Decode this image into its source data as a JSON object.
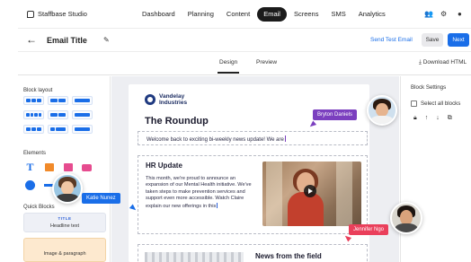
{
  "app": {
    "brand": "Staffbase Studio",
    "nav": [
      "Dashboard",
      "Planning",
      "Content",
      "Email",
      "Screens",
      "SMS",
      "Analytics"
    ],
    "active_nav": "Email"
  },
  "header": {
    "title": "Email Title",
    "send_test": "Send Test Email",
    "save": "Save",
    "next": "Next"
  },
  "tabs": {
    "design": "Design",
    "preview": "Preview",
    "download": "Download HTML"
  },
  "left_panel": {
    "block_layout": "Block layout",
    "elements": "Elements",
    "quick_blocks": "Quick Blocks",
    "quick_block_items": [
      {
        "label": "Headline text",
        "sample": "TITLE"
      },
      {
        "label": "Image & paragraph"
      }
    ]
  },
  "email": {
    "logo": "Vandelay Industries",
    "heading": "The Roundup",
    "intro": "Welcome back to exciting bi-weekly news update! We are",
    "hr_title": "HR Update",
    "hr_body": "This month, we're proud to announce an expansion of our Mental Health initiative.  We've taken steps to make prevention services and support even more accessible. Watch Claire explain our new offerings in this",
    "news_title": "News from the field"
  },
  "right_panel": {
    "title": "Block Settings",
    "select_all": "Select all blocks"
  },
  "collaborators": [
    {
      "name": "Bryton Daniels",
      "color": "#7b3fbf"
    },
    {
      "name": "Katie Nunez",
      "color": "#1a6ee8"
    },
    {
      "name": "Jennifer Ngo",
      "color": "#ea3f5b"
    }
  ],
  "colors": {
    "accent": "#1a6ee8",
    "active_nav_bg": "#1b1b1b"
  }
}
